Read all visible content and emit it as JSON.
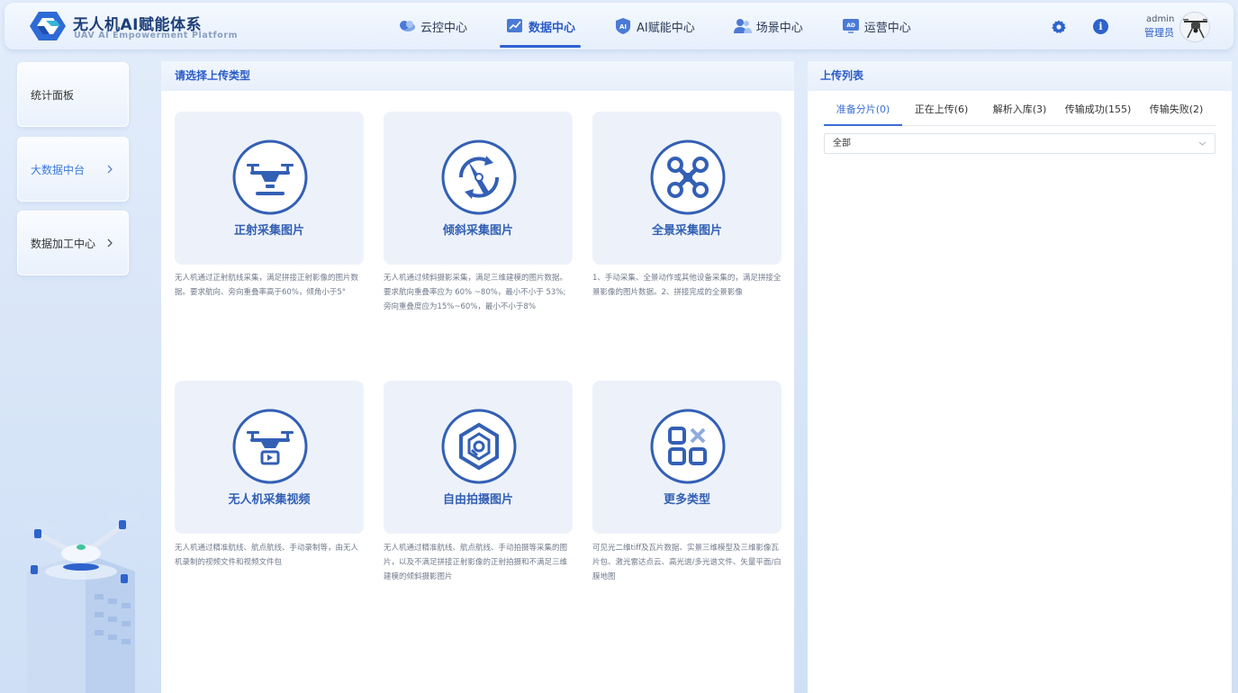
{
  "brand": {
    "title": "无人机AI赋能体系",
    "subtitle": "UAV AI Empowerment Platform"
  },
  "nav": [
    {
      "label": "云控中心",
      "icon": "cloud-control-icon",
      "active": false
    },
    {
      "label": "数据中心",
      "icon": "data-chart-icon",
      "active": true
    },
    {
      "label": "AI赋能中心",
      "icon": "ai-shield-icon",
      "active": false
    },
    {
      "label": "场景中心",
      "icon": "users-icon",
      "active": false
    },
    {
      "label": "运营中心",
      "icon": "ad-monitor-icon",
      "active": false
    }
  ],
  "header_actions": {
    "settings_icon": "gear-icon",
    "info_icon": "info-icon",
    "info_glyph": "i"
  },
  "user": {
    "name": "admin",
    "role": "管理员"
  },
  "sidebar": {
    "items": [
      {
        "label": "统计面板",
        "active": false,
        "has_arrow": false
      },
      {
        "label": "大数据中台",
        "active": true,
        "has_arrow": true
      },
      {
        "label": "数据加工中心",
        "active": false,
        "has_arrow": true
      }
    ]
  },
  "main": {
    "title": "请选择上传类型",
    "cards": [
      {
        "title": "正射采集图片",
        "icon": "drone-orthophoto-icon",
        "desc": "无人机通过正射航线采集，满足拼接正射影像的图片数据。要求航向、旁向重叠率高于60%，倾角小于5°"
      },
      {
        "title": "倾斜采集图片",
        "icon": "oblique-rotate-icon",
        "desc": "无人机通过倾斜摄影采集，满足三维建模的图片数据。要求航向重叠率应为 60% ~80%，最小不小于 53%; 旁向重叠度应为15%~60%，最小不小于8%"
      },
      {
        "title": "全景采集图片",
        "icon": "quadcopter-icon",
        "desc": "1、手动采集、全景动作或其他设备采集的，满足拼接全景影像的图片数据。2、拼接完成的全景影像"
      },
      {
        "title": "无人机采集视频",
        "icon": "drone-video-icon",
        "desc": "无人机通过精准航线、航点航线、手动录制等，由无人机录制的视频文件和视频文件包"
      },
      {
        "title": "自由拍摄图片",
        "icon": "camera-lens-icon",
        "desc": "无人机通过精准航线、航点航线、手动拍摄等采集的图片，以及不满足拼接正射影像的正射拍摄和不满足三维建模的倾斜摄影图片"
      },
      {
        "title": "更多类型",
        "icon": "more-types-icon",
        "desc": "可见光二维tiff及瓦片数据、实景三维模型及三维影像瓦片包、激光雷达点云、高光谱/多光谱文件、矢量平面/白膜地图"
      }
    ]
  },
  "upload_list": {
    "title": "上传列表",
    "tabs": [
      {
        "label": "准备分片(0)",
        "active": true
      },
      {
        "label": "正在上传(6)",
        "active": false
      },
      {
        "label": "解析入库(3)",
        "active": false
      },
      {
        "label": "传输成功(155)",
        "active": false
      },
      {
        "label": "传输失败(2)",
        "active": false
      }
    ],
    "filter": {
      "selected": "全部"
    }
  },
  "colors": {
    "accent": "#2f62d1",
    "card_bg": "#edf2fa",
    "icon_blue": "#3360b5",
    "text_muted": "#707a8c"
  }
}
